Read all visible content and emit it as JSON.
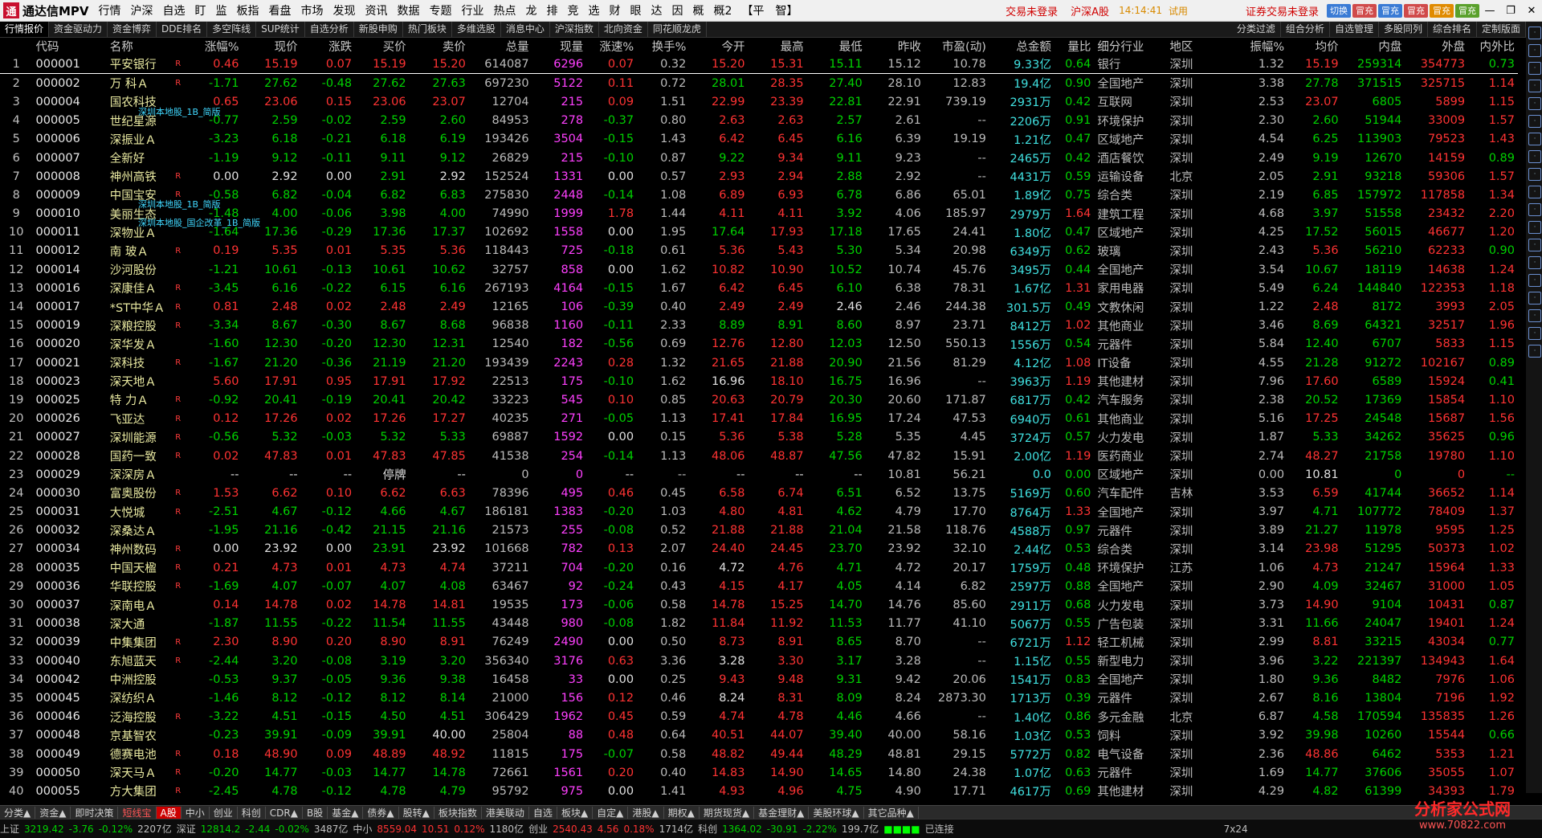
{
  "app": {
    "title": "通达信MPV",
    "logo_mark": "通"
  },
  "menu": [
    "行情",
    "沪深",
    "自选",
    "盯",
    "监",
    "板指",
    "看盘",
    "市场",
    "发现",
    "资讯",
    "数据",
    "专题",
    "行业",
    "热点",
    "龙",
    "排",
    "竞",
    "选",
    "财",
    "眼",
    "达",
    "因",
    "概",
    "概2",
    "【平　智】"
  ],
  "status_links": {
    "login": "交易未登录",
    "market": "沪深A股",
    "time": "14:14:41",
    "tag": "试用",
    "sec_login": "证券交易未登录"
  },
  "toolbar_buttons": [
    "切换",
    "冒充",
    "冒充",
    "冒充",
    "冒充",
    "冒充"
  ],
  "func_tabs": [
    "行情报价",
    "资金驱动力",
    "资金博弈",
    "DDE排名",
    "多空阵线",
    "SUP统计",
    "自选分析",
    "新股申购",
    "热门板块",
    "多维选股",
    "消息中心",
    "沪深指数",
    "北向资金",
    "同花顺龙虎"
  ],
  "func_tabs_right": [
    "分类过滤",
    "组合分析",
    "自选管理",
    "多股同列",
    "综合排名",
    "定制版面"
  ],
  "columns": [
    "",
    "代码",
    "名称",
    "",
    "涨幅%",
    "现价",
    "涨跌",
    "买价",
    "卖价",
    "总量",
    "现量",
    "涨速%",
    "换手%",
    "今开",
    "最高",
    "最低",
    "昨收",
    "市盈(动)",
    "总金额",
    "量比",
    "细分行业",
    "地区",
    "振幅%",
    "均价",
    "内盘",
    "外盘",
    "内外比"
  ],
  "rows": [
    [
      "1",
      "000001",
      "平安银行",
      "R",
      "0.46",
      "15.19",
      "0.07",
      "15.19",
      "15.20",
      "614087",
      "6296",
      "0.07",
      "0.32",
      "15.20",
      "15.31",
      "15.11",
      "15.12",
      "10.78",
      "9.33亿",
      "0.64",
      "银行",
      "深圳",
      "1.32",
      "15.19",
      "259314",
      "354773",
      "0.73"
    ],
    [
      "2",
      "000002",
      "万 科Ａ",
      "R",
      "-1.71",
      "27.62",
      "-0.48",
      "27.62",
      "27.63",
      "697230",
      "5122",
      "0.11",
      "0.72",
      "28.01",
      "28.35",
      "27.40",
      "28.10",
      "12.83",
      "19.4亿",
      "0.90",
      "全国地产",
      "深圳",
      "3.38",
      "27.78",
      "371515",
      "325715",
      "1.14"
    ],
    [
      "3",
      "000004",
      "国农科技",
      "",
      "0.65",
      "23.06",
      "0.15",
      "23.06",
      "23.07",
      "12704",
      "215",
      "0.09",
      "1.51",
      "22.99",
      "23.39",
      "22.81",
      "22.91",
      "739.19",
      "2931万",
      "0.42",
      "互联网",
      "深圳",
      "2.53",
      "23.07",
      "6805",
      "5899",
      "1.15"
    ],
    [
      "4",
      "000005",
      "世纪星源",
      "",
      "-0.77",
      "2.59",
      "-0.02",
      "2.59",
      "2.60",
      "84953",
      "278",
      "-0.37",
      "0.80",
      "2.63",
      "2.63",
      "2.57",
      "2.61",
      "--",
      "2206万",
      "0.91",
      "环境保护",
      "深圳",
      "2.30",
      "2.60",
      "51944",
      "33009",
      "1.57"
    ],
    [
      "5",
      "000006",
      "深振业Ａ",
      "",
      "-3.23",
      "6.18",
      "-0.21",
      "6.18",
      "6.19",
      "193426",
      "3504",
      "-0.15",
      "1.43",
      "6.42",
      "6.45",
      "6.16",
      "6.39",
      "19.19",
      "1.21亿",
      "0.47",
      "区域地产",
      "深圳",
      "4.54",
      "6.25",
      "113903",
      "79523",
      "1.43"
    ],
    [
      "6",
      "000007",
      "全新好",
      "",
      "-1.19",
      "9.12",
      "-0.11",
      "9.11",
      "9.12",
      "26829",
      "215",
      "-0.10",
      "0.87",
      "9.22",
      "9.34",
      "9.11",
      "9.23",
      "--",
      "2465万",
      "0.42",
      "酒店餐饮",
      "深圳",
      "2.49",
      "9.19",
      "12670",
      "14159",
      "0.89"
    ],
    [
      "7",
      "000008",
      "神州高铁",
      "R",
      "0.00",
      "2.92",
      "0.00",
      "2.91",
      "2.92",
      "152524",
      "1331",
      "0.00",
      "0.57",
      "2.93",
      "2.94",
      "2.88",
      "2.92",
      "--",
      "4431万",
      "0.59",
      "运输设备",
      "北京",
      "2.05",
      "2.91",
      "93218",
      "59306",
      "1.57"
    ],
    [
      "8",
      "000009",
      "中国宝安",
      "R",
      "-0.58",
      "6.82",
      "-0.04",
      "6.82",
      "6.83",
      "275830",
      "2448",
      "-0.14",
      "1.08",
      "6.89",
      "6.93",
      "6.78",
      "6.86",
      "65.01",
      "1.89亿",
      "0.75",
      "综合类",
      "深圳",
      "2.19",
      "6.85",
      "157972",
      "117858",
      "1.34"
    ],
    [
      "9",
      "000010",
      "美丽生态",
      "",
      "-1.48",
      "4.00",
      "-0.06",
      "3.98",
      "4.00",
      "74990",
      "1999",
      "1.78",
      "1.44",
      "4.11",
      "4.11",
      "3.92",
      "4.06",
      "185.97",
      "2979万",
      "1.64",
      "建筑工程",
      "深圳",
      "4.68",
      "3.97",
      "51558",
      "23432",
      "2.20"
    ],
    [
      "10",
      "000011",
      "深物业Ａ",
      "",
      "-1.64",
      "17.36",
      "-0.29",
      "17.36",
      "17.37",
      "102692",
      "1558",
      "0.00",
      "1.95",
      "17.64",
      "17.93",
      "17.18",
      "17.65",
      "24.41",
      "1.80亿",
      "0.47",
      "区域地产",
      "深圳",
      "4.25",
      "17.52",
      "56015",
      "46677",
      "1.20"
    ],
    [
      "11",
      "000012",
      "南 玻Ａ",
      "R",
      "0.19",
      "5.35",
      "0.01",
      "5.35",
      "5.36",
      "118443",
      "725",
      "-0.18",
      "0.61",
      "5.36",
      "5.43",
      "5.30",
      "5.34",
      "20.98",
      "6349万",
      "0.62",
      "玻璃",
      "深圳",
      "2.43",
      "5.36",
      "56210",
      "62233",
      "0.90"
    ],
    [
      "12",
      "000014",
      "沙河股份",
      "",
      "-1.21",
      "10.61",
      "-0.13",
      "10.61",
      "10.62",
      "32757",
      "858",
      "0.00",
      "1.62",
      "10.82",
      "10.90",
      "10.52",
      "10.74",
      "45.76",
      "3495万",
      "0.44",
      "全国地产",
      "深圳",
      "3.54",
      "10.67",
      "18119",
      "14638",
      "1.24"
    ],
    [
      "13",
      "000016",
      "深康佳Ａ",
      "R",
      "-3.45",
      "6.16",
      "-0.22",
      "6.15",
      "6.16",
      "267193",
      "4164",
      "-0.15",
      "1.67",
      "6.42",
      "6.45",
      "6.10",
      "6.38",
      "78.31",
      "1.67亿",
      "1.31",
      "家用电器",
      "深圳",
      "5.49",
      "6.24",
      "144840",
      "122353",
      "1.18"
    ],
    [
      "14",
      "000017",
      "*ST中华Ａ",
      "R",
      "0.81",
      "2.48",
      "0.02",
      "2.48",
      "2.49",
      "12165",
      "106",
      "-0.39",
      "0.40",
      "2.49",
      "2.49",
      "2.46",
      "2.46",
      "244.38",
      "301.5万",
      "0.49",
      "文教休闲",
      "深圳",
      "1.22",
      "2.48",
      "8172",
      "3993",
      "2.05"
    ],
    [
      "15",
      "000019",
      "深粮控股",
      "R",
      "-3.34",
      "8.67",
      "-0.30",
      "8.67",
      "8.68",
      "96838",
      "1160",
      "-0.11",
      "2.33",
      "8.89",
      "8.91",
      "8.60",
      "8.97",
      "23.71",
      "8412万",
      "1.02",
      "其他商业",
      "深圳",
      "3.46",
      "8.69",
      "64321",
      "32517",
      "1.96"
    ],
    [
      "16",
      "000020",
      "深华发Ａ",
      "",
      "-1.60",
      "12.30",
      "-0.20",
      "12.30",
      "12.31",
      "12540",
      "182",
      "-0.56",
      "0.69",
      "12.76",
      "12.80",
      "12.03",
      "12.50",
      "550.13",
      "1556万",
      "0.54",
      "元器件",
      "深圳",
      "5.84",
      "12.40",
      "6707",
      "5833",
      "1.15"
    ],
    [
      "17",
      "000021",
      "深科技",
      "R",
      "-1.67",
      "21.20",
      "-0.36",
      "21.19",
      "21.20",
      "193439",
      "2243",
      "0.28",
      "1.32",
      "21.65",
      "21.88",
      "20.90",
      "21.56",
      "81.29",
      "4.12亿",
      "1.08",
      "IT设备",
      "深圳",
      "4.55",
      "21.28",
      "91272",
      "102167",
      "0.89"
    ],
    [
      "18",
      "000023",
      "深天地Ａ",
      "",
      "5.60",
      "17.91",
      "0.95",
      "17.91",
      "17.92",
      "22513",
      "175",
      "-0.10",
      "1.62",
      "16.96",
      "18.10",
      "16.75",
      "16.96",
      "--",
      "3963万",
      "1.19",
      "其他建材",
      "深圳",
      "7.96",
      "17.60",
      "6589",
      "15924",
      "0.41"
    ],
    [
      "19",
      "000025",
      "特 力Ａ",
      "R",
      "-0.92",
      "20.41",
      "-0.19",
      "20.41",
      "20.42",
      "33223",
      "545",
      "0.10",
      "0.85",
      "20.63",
      "20.79",
      "20.30",
      "20.60",
      "171.87",
      "6817万",
      "0.42",
      "汽车服务",
      "深圳",
      "2.38",
      "20.52",
      "17369",
      "15854",
      "1.10"
    ],
    [
      "20",
      "000026",
      "飞亚达",
      "R",
      "0.12",
      "17.26",
      "0.02",
      "17.26",
      "17.27",
      "40235",
      "271",
      "-0.05",
      "1.13",
      "17.41",
      "17.84",
      "16.95",
      "17.24",
      "47.53",
      "6940万",
      "0.61",
      "其他商业",
      "深圳",
      "5.16",
      "17.25",
      "24548",
      "15687",
      "1.56"
    ],
    [
      "21",
      "000027",
      "深圳能源",
      "R",
      "-0.56",
      "5.32",
      "-0.03",
      "5.32",
      "5.33",
      "69887",
      "1592",
      "0.00",
      "0.15",
      "5.36",
      "5.38",
      "5.28",
      "5.35",
      "4.45",
      "3724万",
      "0.57",
      "火力发电",
      "深圳",
      "1.87",
      "5.33",
      "34262",
      "35625",
      "0.96"
    ],
    [
      "22",
      "000028",
      "国药一致",
      "R",
      "0.02",
      "47.83",
      "0.01",
      "47.83",
      "47.85",
      "41538",
      "254",
      "-0.14",
      "1.13",
      "48.06",
      "48.87",
      "47.56",
      "47.82",
      "15.91",
      "2.00亿",
      "1.19",
      "医药商业",
      "深圳",
      "2.74",
      "48.27",
      "21758",
      "19780",
      "1.10"
    ],
    [
      "23",
      "000029",
      "深深房Ａ",
      "",
      "--",
      "--",
      "--",
      "停牌",
      "--",
      "0",
      "0",
      "--",
      "--",
      "--",
      "--",
      "--",
      "10.81",
      "56.21",
      "0.0",
      "0.00",
      "区域地产",
      "深圳",
      "0.00",
      "10.81",
      "0",
      "0",
      "--"
    ],
    [
      "24",
      "000030",
      "富奥股份",
      "R",
      "1.53",
      "6.62",
      "0.10",
      "6.62",
      "6.63",
      "78396",
      "495",
      "0.46",
      "0.45",
      "6.58",
      "6.74",
      "6.51",
      "6.52",
      "13.75",
      "5169万",
      "0.60",
      "汽车配件",
      "吉林",
      "3.53",
      "6.59",
      "41744",
      "36652",
      "1.14"
    ],
    [
      "25",
      "000031",
      "大悦城",
      "R",
      "-2.51",
      "4.67",
      "-0.12",
      "4.66",
      "4.67",
      "186181",
      "1383",
      "-0.20",
      "1.03",
      "4.80",
      "4.81",
      "4.62",
      "4.79",
      "17.70",
      "8764万",
      "1.33",
      "全国地产",
      "深圳",
      "3.97",
      "4.71",
      "107772",
      "78409",
      "1.37"
    ],
    [
      "26",
      "000032",
      "深桑达Ａ",
      "",
      "-1.95",
      "21.16",
      "-0.42",
      "21.15",
      "21.16",
      "21573",
      "255",
      "-0.08",
      "0.52",
      "21.88",
      "21.88",
      "21.04",
      "21.58",
      "118.76",
      "4588万",
      "0.97",
      "元器件",
      "深圳",
      "3.89",
      "21.27",
      "11978",
      "9595",
      "1.25"
    ],
    [
      "27",
      "000034",
      "神州数码",
      "R",
      "0.00",
      "23.92",
      "0.00",
      "23.91",
      "23.92",
      "101668",
      "782",
      "0.13",
      "2.07",
      "24.40",
      "24.45",
      "23.70",
      "23.92",
      "32.10",
      "2.44亿",
      "0.53",
      "综合类",
      "深圳",
      "3.14",
      "23.98",
      "51295",
      "50373",
      "1.02"
    ],
    [
      "28",
      "000035",
      "中国天楹",
      "R",
      "0.21",
      "4.73",
      "0.01",
      "4.73",
      "4.74",
      "37211",
      "704",
      "-0.20",
      "0.16",
      "4.72",
      "4.76",
      "4.71",
      "4.72",
      "20.17",
      "1759万",
      "0.48",
      "环境保护",
      "江苏",
      "1.06",
      "4.73",
      "21247",
      "15964",
      "1.33"
    ],
    [
      "29",
      "000036",
      "华联控股",
      "R",
      "-1.69",
      "4.07",
      "-0.07",
      "4.07",
      "4.08",
      "63467",
      "92",
      "-0.24",
      "0.43",
      "4.15",
      "4.17",
      "4.05",
      "4.14",
      "6.82",
      "2597万",
      "0.88",
      "全国地产",
      "深圳",
      "2.90",
      "4.09",
      "32467",
      "31000",
      "1.05"
    ],
    [
      "30",
      "000037",
      "深南电Ａ",
      "",
      "0.14",
      "14.78",
      "0.02",
      "14.78",
      "14.81",
      "19535",
      "173",
      "-0.06",
      "0.58",
      "14.78",
      "15.25",
      "14.70",
      "14.76",
      "85.60",
      "2911万",
      "0.68",
      "火力发电",
      "深圳",
      "3.73",
      "14.90",
      "9104",
      "10431",
      "0.87"
    ],
    [
      "31",
      "000038",
      "深大通",
      "",
      "-1.87",
      "11.55",
      "-0.22",
      "11.54",
      "11.55",
      "43448",
      "980",
      "-0.08",
      "1.82",
      "11.84",
      "11.92",
      "11.53",
      "11.77",
      "41.10",
      "5067万",
      "0.55",
      "广告包装",
      "深圳",
      "3.31",
      "11.66",
      "24047",
      "19401",
      "1.24"
    ],
    [
      "32",
      "000039",
      "中集集团",
      "R",
      "2.30",
      "8.90",
      "0.20",
      "8.90",
      "8.91",
      "76249",
      "2490",
      "0.00",
      "0.50",
      "8.73",
      "8.91",
      "8.65",
      "8.70",
      "--",
      "6721万",
      "1.12",
      "轻工机械",
      "深圳",
      "2.99",
      "8.81",
      "33215",
      "43034",
      "0.77"
    ],
    [
      "33",
      "000040",
      "东旭蓝天",
      "R",
      "-2.44",
      "3.20",
      "-0.08",
      "3.19",
      "3.20",
      "356340",
      "3176",
      "0.63",
      "3.36",
      "3.28",
      "3.30",
      "3.17",
      "3.28",
      "--",
      "1.15亿",
      "0.55",
      "新型电力",
      "深圳",
      "3.96",
      "3.22",
      "221397",
      "134943",
      "1.64"
    ],
    [
      "34",
      "000042",
      "中洲控股",
      "",
      "-0.53",
      "9.37",
      "-0.05",
      "9.36",
      "9.38",
      "16458",
      "33",
      "0.00",
      "0.25",
      "9.43",
      "9.48",
      "9.31",
      "9.42",
      "20.06",
      "1541万",
      "0.83",
      "全国地产",
      "深圳",
      "1.80",
      "9.36",
      "8482",
      "7976",
      "1.06"
    ],
    [
      "35",
      "000045",
      "深纺织Ａ",
      "",
      "-1.46",
      "8.12",
      "-0.12",
      "8.12",
      "8.14",
      "21000",
      "156",
      "0.12",
      "0.46",
      "8.24",
      "8.31",
      "8.09",
      "8.24",
      "2873.30",
      "1713万",
      "0.39",
      "元器件",
      "深圳",
      "2.67",
      "8.16",
      "13804",
      "7196",
      "1.92"
    ],
    [
      "36",
      "000046",
      "泛海控股",
      "R",
      "-3.22",
      "4.51",
      "-0.15",
      "4.50",
      "4.51",
      "306429",
      "1962",
      "0.45",
      "0.59",
      "4.74",
      "4.78",
      "4.46",
      "4.66",
      "--",
      "1.40亿",
      "0.86",
      "多元金融",
      "北京",
      "6.87",
      "4.58",
      "170594",
      "135835",
      "1.26"
    ],
    [
      "37",
      "000048",
      "京基智农",
      "",
      "-0.23",
      "39.91",
      "-0.09",
      "39.91",
      "40.00",
      "25804",
      "88",
      "0.48",
      "0.64",
      "40.51",
      "44.07",
      "39.40",
      "40.00",
      "58.16",
      "1.03亿",
      "0.53",
      "饲料",
      "深圳",
      "3.92",
      "39.98",
      "10260",
      "15544",
      "0.66"
    ],
    [
      "38",
      "000049",
      "德赛电池",
      "R",
      "0.18",
      "48.90",
      "0.09",
      "48.89",
      "48.92",
      "11815",
      "175",
      "-0.07",
      "0.58",
      "48.82",
      "49.44",
      "48.29",
      "48.81",
      "29.15",
      "5772万",
      "0.82",
      "电气设备",
      "深圳",
      "2.36",
      "48.86",
      "6462",
      "5353",
      "1.21"
    ],
    [
      "39",
      "000050",
      "深天马Ａ",
      "R",
      "-0.20",
      "14.77",
      "-0.03",
      "14.77",
      "14.78",
      "72661",
      "1561",
      "0.20",
      "0.40",
      "14.83",
      "14.90",
      "14.65",
      "14.80",
      "24.38",
      "1.07亿",
      "0.63",
      "元器件",
      "深圳",
      "1.69",
      "14.77",
      "37606",
      "35055",
      "1.07"
    ],
    [
      "40",
      "000055",
      "方大集团",
      "R",
      "-2.45",
      "4.78",
      "-0.12",
      "4.78",
      "4.79",
      "95792",
      "975",
      "0.00",
      "1.41",
      "4.93",
      "4.96",
      "4.75",
      "4.90",
      "17.71",
      "4617万",
      "0.69",
      "其他建材",
      "深圳",
      "4.29",
      "4.82",
      "61399",
      "34393",
      "1.79"
    ]
  ],
  "annotations": {
    "a5": "深圳本地股_1B_简版",
    "a10": "深圳本地股_1B_简版",
    "a12": "深圳本地股_国企改革_1B_简版"
  },
  "bottom_tabs": [
    "分类▲",
    "资金▲",
    "即时决策",
    "短线宝",
    "A股",
    "中小",
    "创业",
    "科创",
    "CDR▲",
    "B股",
    "基金▲",
    "债券▲",
    "股转▲",
    "板块指数",
    "港美联动",
    "自选",
    "板块▲",
    "自定▲",
    "港股▲",
    "期权▲",
    "期货现货▲",
    "基金理财▲",
    "美股环球▲",
    "其它品种▲"
  ],
  "status": {
    "sh_label": "上证",
    "sh_val": "3219.42",
    "sh_chg": "-3.76",
    "sh_pct": "-0.12%",
    "sh_amt": "2207亿",
    "sz_label": "深证",
    "sz_val": "12814.2",
    "sz_chg": "-2.44",
    "sz_pct": "-0.02%",
    "sz_amt": "3487亿",
    "zx_label": "中小",
    "zx_val": "8559.04",
    "zx_chg": "10.51",
    "zx_pct": "0.12%",
    "zx_amt": "1180亿",
    "cy_label": "创业",
    "cy_val": "2540.43",
    "cy_chg": "4.56",
    "cy_pct": "0.18%",
    "cy_amt": "1714亿",
    "kc_label": "科创",
    "kc_val": "1364.02",
    "kc_chg": "-30.91",
    "kc_pct": "-2.22%",
    "kc_amt": "199.7亿",
    "conn": "已连接",
    "grid": "7x24"
  },
  "footer_logo": {
    "line1": "分析家公式网",
    "line2": "www.70822.com"
  },
  "colors": {
    "up": "#ff3333",
    "down": "#00d200",
    "vol": "#e0e040",
    "bg": "#000000"
  }
}
